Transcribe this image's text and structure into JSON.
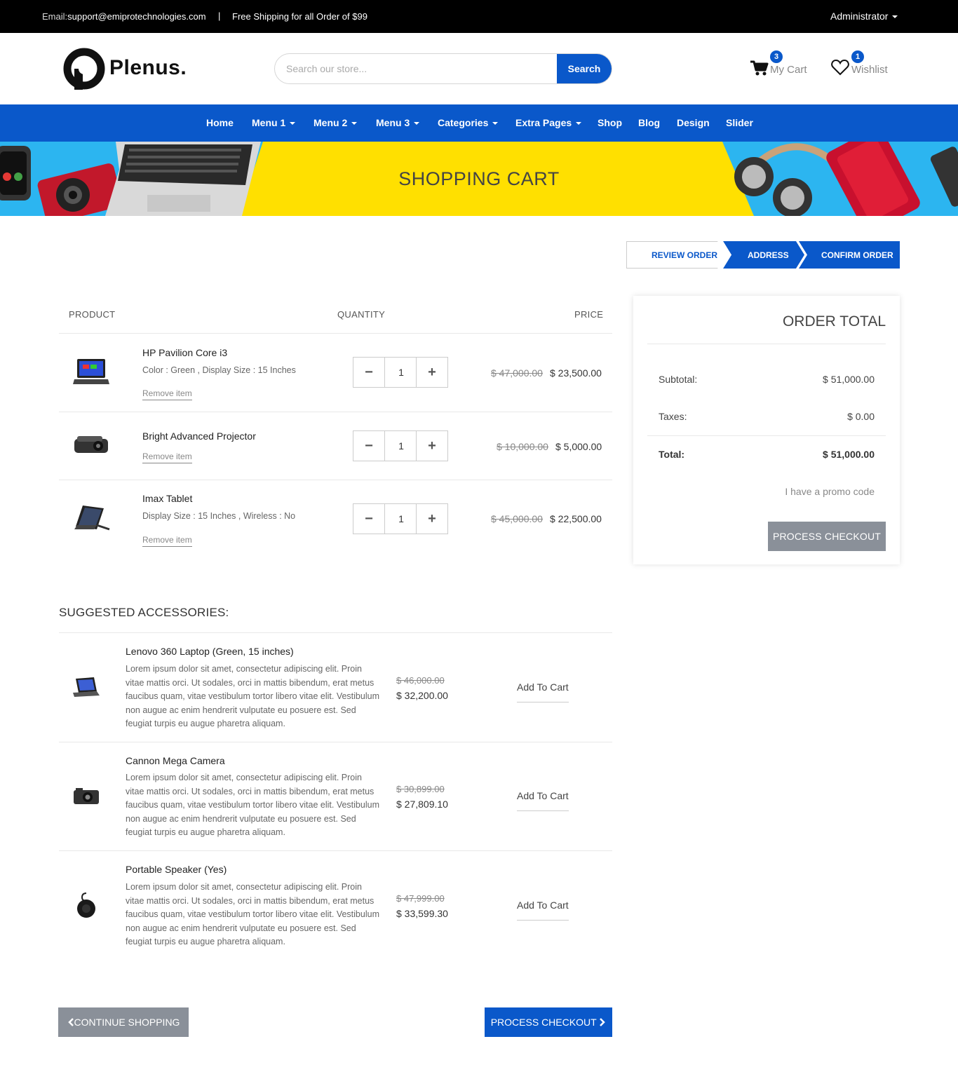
{
  "topbar": {
    "email_label": "Email:",
    "email": "support@emiprotechnologies.com",
    "separator": "|",
    "shipping": "Free Shipping for all Order of $99",
    "user": "Administrator"
  },
  "header": {
    "logo_text": "Plenus.",
    "search_placeholder": "Search our store...",
    "search_button": "Search",
    "cart_label": "My Cart",
    "cart_count": "3",
    "wishlist_label": "Wishlist",
    "wishlist_count": "1"
  },
  "nav": {
    "items": [
      "Home",
      "Menu 1",
      "Menu 2",
      "Menu 3",
      "Categories",
      "Extra Pages",
      "Shop",
      "Blog",
      "Design",
      "Slider"
    ]
  },
  "banner": {
    "title": "SHOPPING CART"
  },
  "steps": [
    "REVIEW ORDER",
    "ADDRESS",
    "CONFIRM ORDER"
  ],
  "cart": {
    "headers": {
      "product": "PRODUCT",
      "quantity": "QUANTITY",
      "price": "PRICE"
    },
    "remove_label": "Remove item",
    "items": [
      {
        "name": "HP Pavilion Core i3",
        "attrs": "Color : Green , Display Size : 15 Inches",
        "qty": "1",
        "old_price": "$ 47,000.00",
        "price": "$ 23,500.00"
      },
      {
        "name": "Bright Advanced Projector",
        "attrs": "",
        "qty": "1",
        "old_price": "$ 10,000.00",
        "price": "$ 5,000.00"
      },
      {
        "name": "Imax Tablet",
        "attrs": "Display Size : 15 Inches , Wireless : No",
        "qty": "1",
        "old_price": "$ 45,000.00",
        "price": "$ 22,500.00"
      }
    ]
  },
  "order_total": {
    "title": "ORDER TOTAL",
    "subtotal_label": "Subtotal:",
    "subtotal": "$ 51,000.00",
    "taxes_label": "Taxes:",
    "taxes": "$ 0.00",
    "total_label": "Total:",
    "total": "$ 51,000.00",
    "promo": "I have a promo code",
    "checkout": "PROCESS CHECKOUT"
  },
  "suggested": {
    "title": "SUGGESTED ACCESSORIES:",
    "add_label": "Add To Cart",
    "items": [
      {
        "name": "Lenovo 360 Laptop (Green, 15 inches)",
        "desc": "Lorem ipsum dolor sit amet, consectetur adipiscing elit. Proin vitae mattis orci. Ut sodales, orci in mattis bibendum, erat metus faucibus quam, vitae vestibulum tortor libero vitae elit. Vestibulum non augue ac enim hendrerit vulputate eu posuere est. Sed feugiat turpis eu augue pharetra aliquam.",
        "old_price": "$ 46,000.00",
        "price": "$ 32,200.00"
      },
      {
        "name": "Cannon Mega Camera",
        "desc": "Lorem ipsum dolor sit amet, consectetur adipiscing elit. Proin vitae mattis orci. Ut sodales, orci in mattis bibendum, erat metus faucibus quam, vitae vestibulum tortor libero vitae elit. Vestibulum non augue ac enim hendrerit vulputate eu posuere est. Sed feugiat turpis eu augue pharetra aliquam.",
        "old_price": "$ 30,899.00",
        "price": "$ 27,809.10"
      },
      {
        "name": "Portable Speaker (Yes)",
        "desc": "Lorem ipsum dolor sit amet, consectetur adipiscing elit. Proin vitae mattis orci. Ut sodales, orci in mattis bibendum, erat metus faucibus quam, vitae vestibulum tortor libero vitae elit. Vestibulum non augue ac enim hendrerit vulputate eu posuere est. Sed feugiat turpis eu augue pharetra aliquam.",
        "old_price": "$ 47,999.00",
        "price": "$ 33,599.30"
      }
    ]
  },
  "footer_buttons": {
    "continue": "CONTINUE SHOPPING",
    "checkout": "PROCESS CHECKOUT"
  },
  "colors": {
    "primary": "#0a58ca",
    "banner_yellow": "#ffe000",
    "topbar": "#000000",
    "grey_button": "#8a9099"
  },
  "icons": [
    "logo-mark-icon",
    "cart-icon",
    "heart-icon",
    "chevron-left-icon",
    "chevron-right-icon",
    "minus-icon",
    "plus-icon"
  ]
}
